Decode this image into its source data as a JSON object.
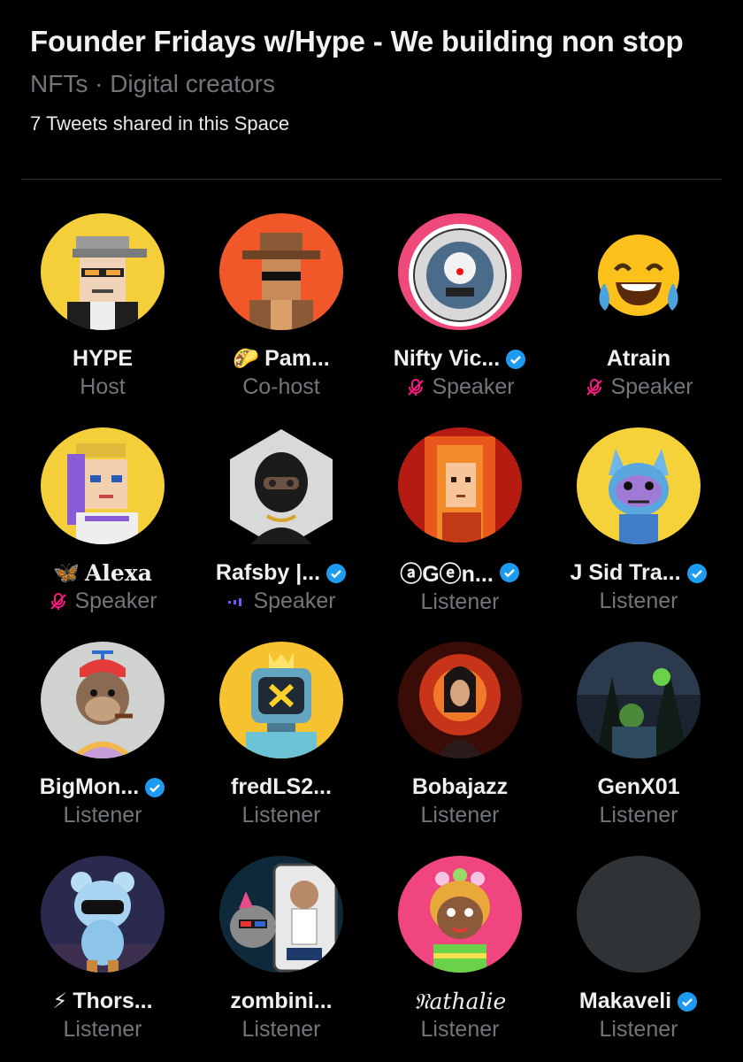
{
  "space": {
    "title": "Founder Fridays w/Hype - We building non stop",
    "topics": "NFTs · Digital creators",
    "tweets_shared": "7 Tweets shared in this Space"
  },
  "colors": {
    "background": "#000000",
    "muted": "#71767b",
    "verified": "#1d9bf0",
    "mic_off": "#f91880",
    "speaking": "#7856ff"
  },
  "participants": [
    {
      "name": "HYPE",
      "role": "Host",
      "verified": false,
      "status": "none",
      "avatar_icon": "pixel-capped-avatar"
    },
    {
      "name": "Pam...",
      "prefix": "🌮",
      "role": "Co-host",
      "verified": false,
      "status": "none",
      "avatar_icon": "pixel-cowboy-avatar"
    },
    {
      "name": "Nifty Vic...",
      "role": "Speaker",
      "verified": true,
      "status": "muted",
      "avatar_icon": "clown-badge-avatar"
    },
    {
      "name": "Atrain",
      "role": "Speaker",
      "verified": false,
      "status": "muted",
      "avatar_icon": "laughing-emoji-avatar"
    },
    {
      "name": "Alexa",
      "prefix": "🦋",
      "role": "Speaker",
      "verified": false,
      "status": "muted",
      "avatar_icon": "pixel-queen-avatar"
    },
    {
      "name": "Rafsby |...",
      "role": "Speaker",
      "verified": true,
      "status": "speaking",
      "avatar_icon": "masked-3d-avatar"
    },
    {
      "name": "ⓐGⓔn...",
      "role": "Listener",
      "verified": true,
      "status": "none",
      "avatar_icon": "pixel-fire-avatar"
    },
    {
      "name": "J Sid Tra...",
      "role": "Listener",
      "verified": true,
      "status": "none",
      "avatar_icon": "neon-cat-avatar"
    },
    {
      "name": "BigMon...",
      "role": "Listener",
      "verified": true,
      "status": "none",
      "avatar_icon": "ape-propeller-avatar"
    },
    {
      "name": "fredLS2...",
      "role": "Listener",
      "verified": false,
      "status": "none",
      "avatar_icon": "robot-x-avatar"
    },
    {
      "name": "Bobajazz",
      "role": "Listener",
      "verified": false,
      "status": "none",
      "avatar_icon": "dragon-warrior-avatar"
    },
    {
      "name": "GenX01",
      "role": "Listener",
      "verified": false,
      "status": "none",
      "avatar_icon": "dark-forest-avatar"
    },
    {
      "name": "Thors...",
      "prefix": "⚡",
      "role": "Listener",
      "verified": false,
      "status": "none",
      "avatar_icon": "crystal-bear-avatar"
    },
    {
      "name": "zombini...",
      "role": "Listener",
      "verified": false,
      "status": "none",
      "avatar_icon": "homies-cat-avatar"
    },
    {
      "name": "𝔑athalie",
      "role": "Listener",
      "verified": false,
      "status": "none",
      "avatar_icon": "flower-crown-avatar"
    },
    {
      "name": "Makaveli",
      "role": "Listener",
      "verified": true,
      "status": "none",
      "avatar_icon": "empty-avatar"
    }
  ]
}
